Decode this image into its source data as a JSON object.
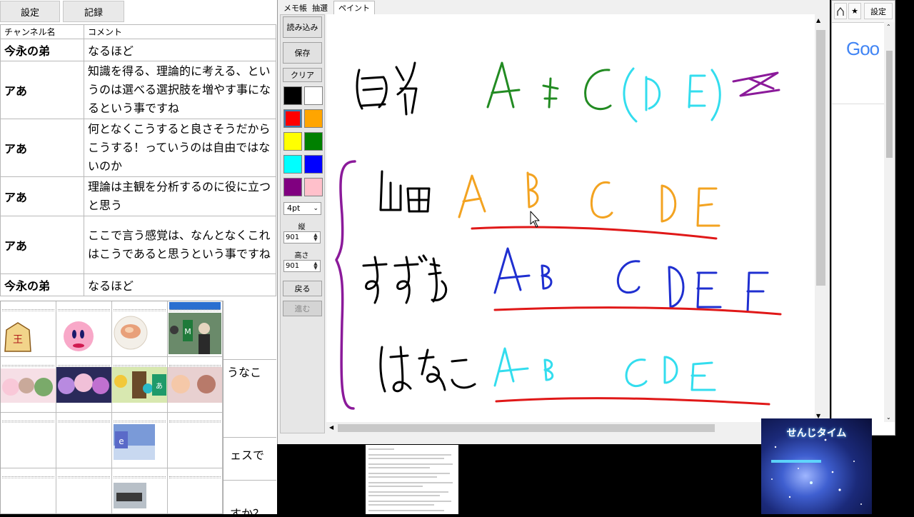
{
  "left_panel": {
    "settings_button": "設定",
    "record_button": "記録",
    "table": {
      "col_channel": "チャンネル名",
      "col_comment": "コメント",
      "rows": [
        {
          "name": "今永の弟",
          "comment": "なるほど"
        },
        {
          "name": "アあ",
          "comment": "知識を得る、理論的に考える、というのは選べる選択肢を増やす事になるという事ですね"
        },
        {
          "name": "アあ",
          "comment": "何となくこうすると良さそうだからこうする！っていうのは自由ではないのか"
        },
        {
          "name": "アあ",
          "comment": "理論は主観を分析するのに役に立つと思う"
        },
        {
          "name": "アあ",
          "comment": "ここで言う感覚は、なんとなくこれはこうであると思うという事ですね"
        },
        {
          "name": "今永の弟",
          "comment": "なるほど"
        }
      ],
      "partial_texts": [
        "うなこ",
        "ェスで",
        "すか？"
      ]
    }
  },
  "paint_window": {
    "tabs": [
      "メモ帳",
      "抽選",
      "ペイント"
    ],
    "active_tab": "ペイント",
    "buttons": {
      "load": "読み込み",
      "save": "保存",
      "clear": "クリア",
      "back": "戻る",
      "forward": "進む"
    },
    "pen_size": "4pt",
    "width_label": "縦",
    "width_value": "901",
    "height_label": "高さ",
    "height_value": "901",
    "palette": [
      "#000000",
      "#ffffff",
      "#ff0000",
      "#ffa500",
      "#ffff00",
      "#008000",
      "#00ffff",
      "#0000ff",
      "#800080",
      "#ffc0cb"
    ],
    "selected_color_index": 2
  },
  "browser": {
    "settings_button": "設定",
    "logo_text": "Goo",
    "star_icon": "star-icon",
    "home_icon": "home-icon"
  },
  "overlay": {
    "senji_title": "せんじタイム"
  },
  "colors": {
    "paint_black": "#000000",
    "paint_green": "#228b22",
    "paint_cyan": "#33ddee",
    "paint_purple": "#8b1a9a",
    "paint_orange": "#f3a321",
    "paint_blue": "#1f2fd0",
    "paint_red": "#e01818"
  }
}
